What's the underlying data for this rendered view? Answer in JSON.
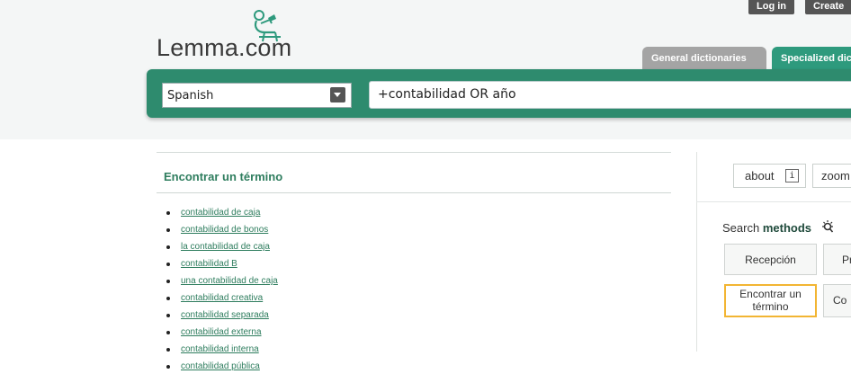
{
  "top_bar": {
    "login_label": "Log in",
    "create_label": "Create"
  },
  "logo": {
    "text": "Lemma.com"
  },
  "tabs": [
    {
      "label": "General dictionaries",
      "active": false
    },
    {
      "label": "Specialized dictionaries",
      "active": true
    }
  ],
  "search": {
    "language_selected": "Spanish",
    "query": "+contabilidad OR año"
  },
  "main_panel": {
    "title": "Encontrar un término",
    "results": [
      "contabilidad de caja",
      "contabilidad de bonos",
      "la contabilidad de caja",
      "contabilidad B",
      "una contabilidad de caja",
      "contabilidad creativa",
      "contabilidad separada",
      "contabilidad externa",
      "contabilidad interna",
      "contabilidad pública"
    ]
  },
  "sidebar": {
    "about_label": "about",
    "info_glyph": "i",
    "zoom_label": "zoom",
    "methods_prefix": "Search",
    "methods_bold": "methods",
    "method_buttons": [
      "Recepción",
      "Pr",
      "Encontrar un término",
      "Co"
    ]
  },
  "colors": {
    "brand_green": "#2e8b6e",
    "link_green": "#2e7d5e",
    "tab_inactive": "#a4a4a4",
    "highlight": "#f2b533"
  }
}
